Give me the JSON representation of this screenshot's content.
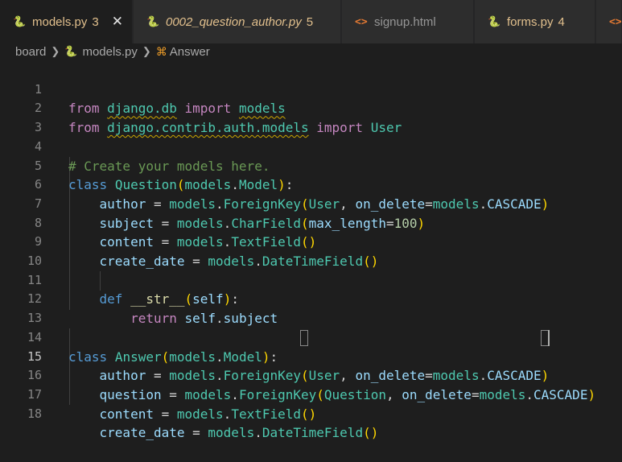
{
  "tabs": [
    {
      "label": "models.py",
      "count": "3",
      "icon": "python-icon",
      "active": true,
      "modified_color": "#e2c08d"
    },
    {
      "label": "0002_question_author.py",
      "count": "5",
      "icon": "python-icon",
      "italic": true
    },
    {
      "label": "signup.html",
      "icon": "html-icon"
    },
    {
      "label": "forms.py",
      "count": "4",
      "icon": "python-icon"
    },
    {
      "icon": "html-icon"
    }
  ],
  "breadcrumb": {
    "folder": "board",
    "file": "models.py",
    "symbol": "Answer"
  },
  "editor": {
    "current_line": 15,
    "line_numbers": [
      "1",
      "2",
      "3",
      "4",
      "5",
      "6",
      "7",
      "8",
      "9",
      "10",
      "11",
      "12",
      "13",
      "14",
      "15",
      "16",
      "17",
      "18"
    ]
  },
  "colors": {
    "background": "#1e1e1e",
    "tab_background": "#2d2d2d",
    "keyword": "#c586c0",
    "type": "#4ec9b0",
    "variable": "#9cdcfe",
    "comment": "#6a9955"
  }
}
